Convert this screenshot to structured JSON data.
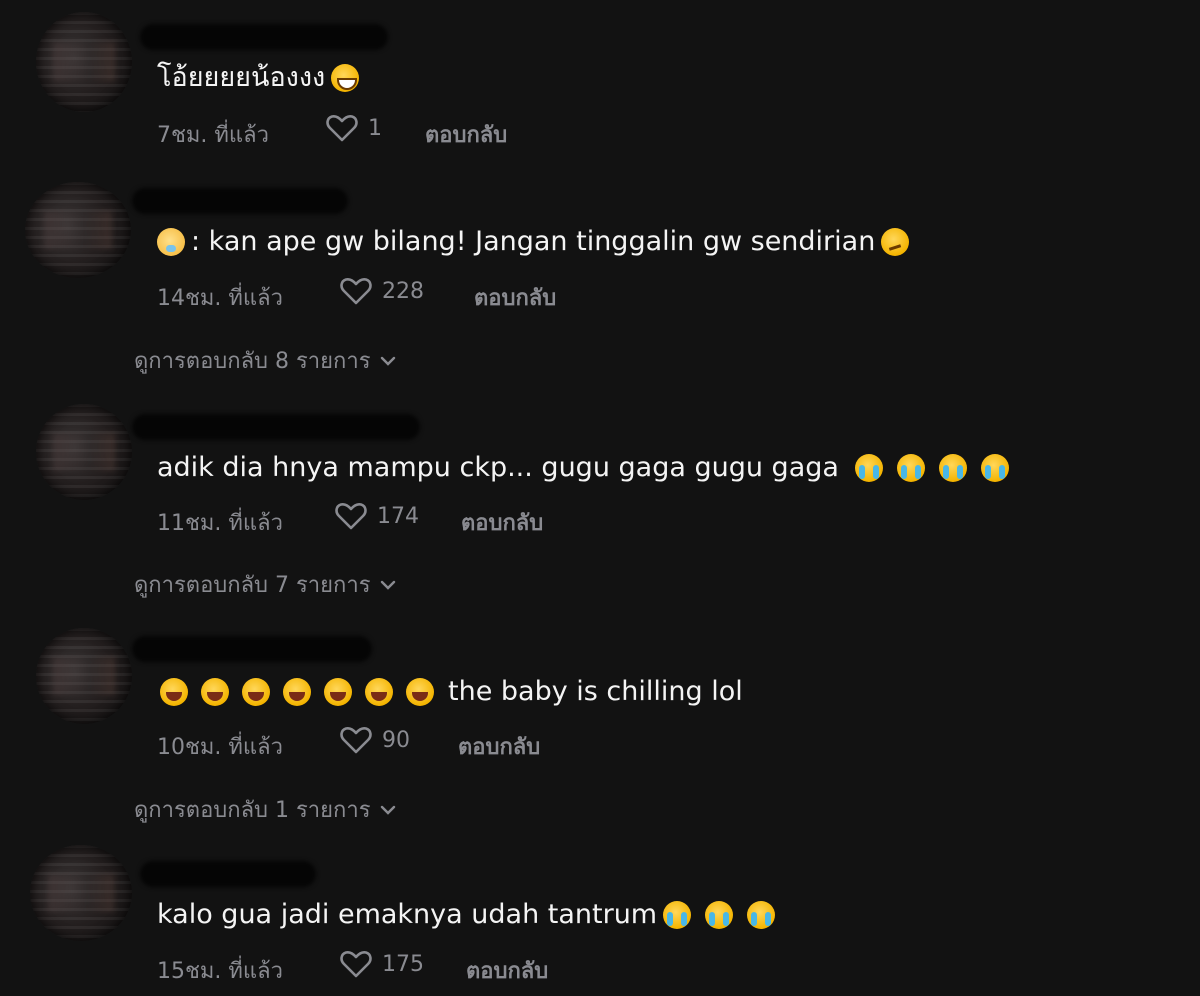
{
  "comments": [
    {
      "text": "โอ้ยยยยน้องงง",
      "time": "7ชม. ที่แล้ว",
      "likes": "1",
      "reply_label": "ตอบกลับ"
    },
    {
      "text": ": kan ape gw bilang! Jangan tinggalin gw sendirian",
      "time": "14ชม. ที่แล้ว",
      "likes": "228",
      "reply_label": "ตอบกลับ",
      "view_replies": "ดูการตอบกลับ 8 รายการ"
    },
    {
      "text": "adik dia hnya mampu ckp... gugu gaga gugu gaga",
      "time": "11ชม. ที่แล้ว",
      "likes": "174",
      "reply_label": "ตอบกลับ",
      "view_replies": "ดูการตอบกลับ 7 รายการ"
    },
    {
      "text": "the baby is chilling lol",
      "time": "10ชม. ที่แล้ว",
      "likes": "90",
      "reply_label": "ตอบกลับ",
      "view_replies": "ดูการตอบกลับ 1 รายการ"
    },
    {
      "text": "kalo gua jadi emaknya udah tantrum",
      "time": "15ชม. ที่แล้ว",
      "likes": "175",
      "reply_label": "ตอบกลับ"
    }
  ],
  "icons": {
    "like": "heart-outline-icon",
    "expand": "chevron-down-icon",
    "emoji_grin": "grinning-squinting-face",
    "emoji_baby": "baby-face",
    "emoji_confused": "confused-face",
    "emoji_cry": "loudly-crying-face",
    "emoji_laugh": "grinning-face-with-big-eyes"
  },
  "colors": {
    "background": "#121212",
    "text": "#f1f1f2",
    "meta": "#8a8b91"
  }
}
